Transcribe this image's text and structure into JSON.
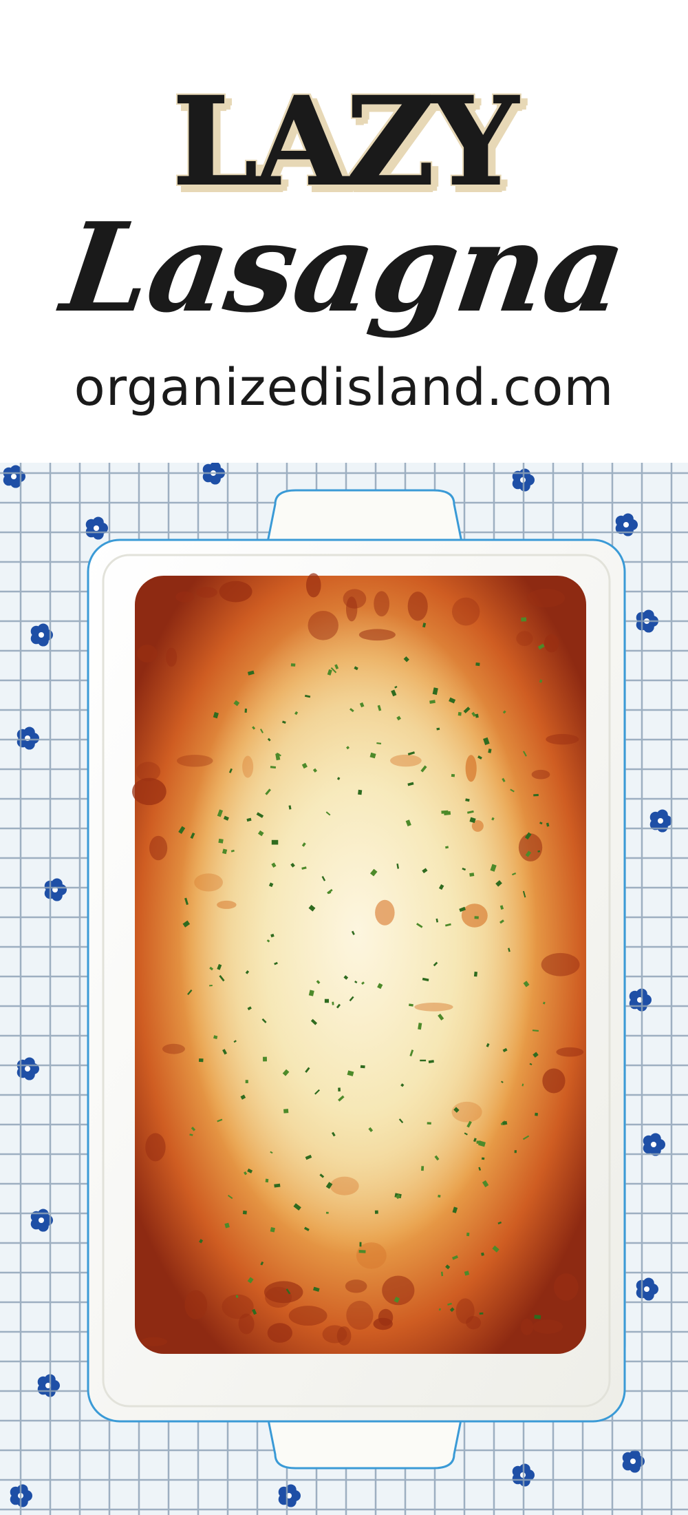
{
  "header": {
    "title_line1": "LAZY",
    "title_line2": "Lasagna",
    "site_url": "organizedisland.com"
  },
  "colors": {
    "title_text": "#1a1a1a",
    "title_shadow": "#e7d8b6",
    "background": "#ffffff",
    "tablecloth": "#eef4f8",
    "flower_blue": "#1e4fa6",
    "dish": "#fbfbf7",
    "dish_edge": "#3a9ad6",
    "sauce": "#c2461c",
    "cheese": "#f3e3a8",
    "parsley": "#2f6b1f"
  },
  "photo": {
    "subject": "lasagna-in-white-baking-dish-on-cooling-rack"
  }
}
